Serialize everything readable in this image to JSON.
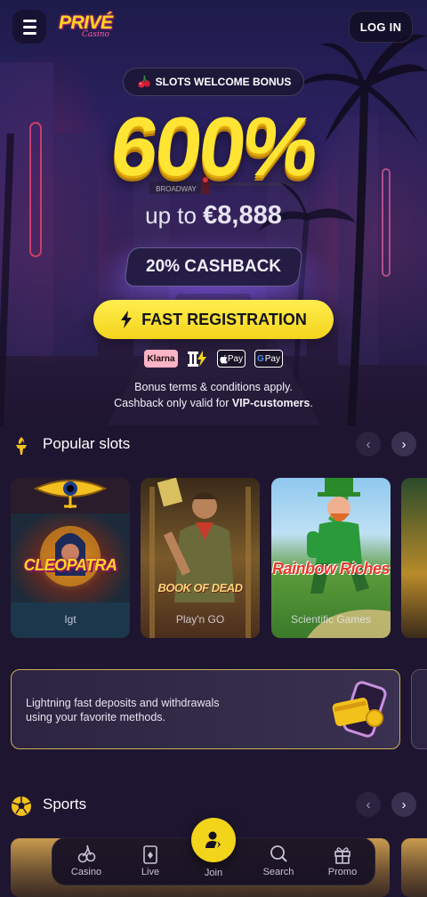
{
  "header": {
    "logo_main": "PRIVÉ",
    "logo_sub": "Casino",
    "login_label": "LOG IN"
  },
  "hero": {
    "promo_pill": "SLOTS WELCOME BONUS",
    "bonus_percent": "600%",
    "bonus_upto": "up to",
    "bonus_amount": "€8,888",
    "cashback": "20% CASHBACK",
    "registration_label": "FAST REGISTRATION",
    "street_sign": "BROADWAY",
    "payments": {
      "klarna": "Klarna",
      "apple": "Pay",
      "google": "Pay"
    },
    "terms_line1": "Bonus terms & conditions apply.",
    "terms_line2_prefix": "Cashback only valid for ",
    "terms_line2_bold": "VIP-customers",
    "terms_line2_suffix": "."
  },
  "popular_slots": {
    "title": "Popular slots",
    "items": [
      {
        "name": "CLEOPATRA",
        "provider": "Igt"
      },
      {
        "name": "BOOK OF DEAD",
        "provider": "Play'n GO"
      },
      {
        "name": "Rainbow Riches",
        "provider": "Scientific Games"
      }
    ]
  },
  "info_card": {
    "line1": "Lightning fast deposits and withdrawals",
    "line2": "using your favorite methods."
  },
  "sports": {
    "title": "Sports"
  },
  "bottom_nav": {
    "items": [
      {
        "label": "Casino",
        "icon": "cherries-icon"
      },
      {
        "label": "Live",
        "icon": "cards-icon"
      },
      {
        "label": "Join",
        "icon": "join-user-icon"
      },
      {
        "label": "Search",
        "icon": "search-icon"
      },
      {
        "label": "Promo",
        "icon": "gift-icon"
      }
    ]
  },
  "colors": {
    "accent_yellow": "#f2d41b",
    "background": "#1e1530",
    "card_border_gold": "#c8b25a"
  }
}
